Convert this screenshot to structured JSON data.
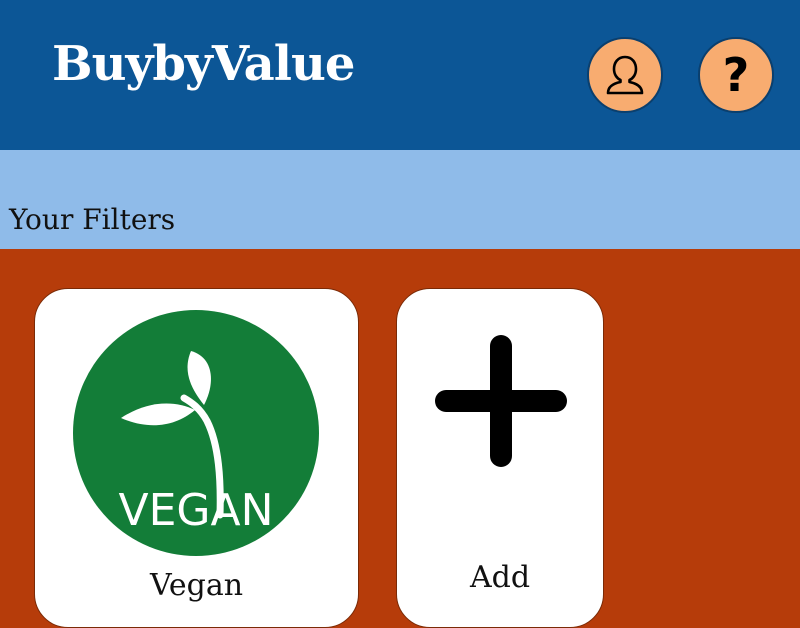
{
  "header": {
    "brand": "BuybyValue",
    "account_icon": "user-icon",
    "help_icon": "question-mark-icon",
    "help_glyph": "?"
  },
  "filters": {
    "title": "Your Filters",
    "items": [
      {
        "label": "Vegan",
        "icon": "vegan-badge-icon",
        "badge_text": "VEGAN"
      }
    ],
    "add_label": "Add",
    "add_icon": "plus-icon"
  },
  "colors": {
    "header_bg": "#0c5696",
    "filters_bar_bg": "#8fbbe9",
    "content_bg": "#b63c0a",
    "button_bg": "#f8ac70",
    "vegan_green": "#137d38"
  }
}
